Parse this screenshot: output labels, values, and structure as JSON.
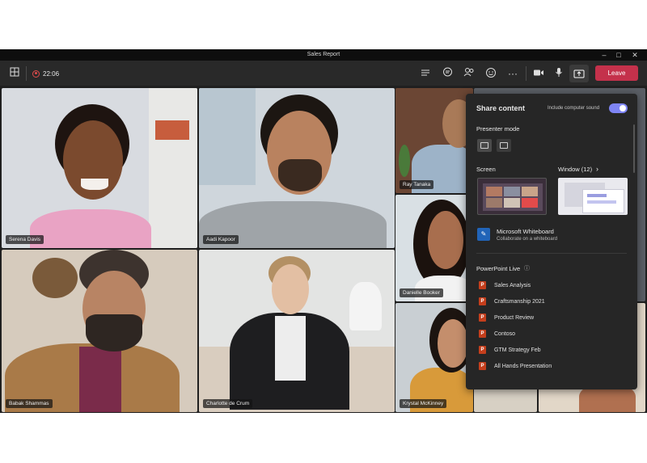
{
  "window": {
    "title": "Sales Report"
  },
  "toolbar": {
    "timer": "22:06",
    "leave_label": "Leave"
  },
  "participants": [
    {
      "name": "Serena Davis"
    },
    {
      "name": "Aadi Kapoor"
    },
    {
      "name": "Ray Tanaka"
    },
    {
      "name": "Danielle Booker"
    },
    {
      "name": "Babak Shammas"
    },
    {
      "name": "Charlotte de Crum"
    },
    {
      "name": "Krystal McKinney"
    }
  ],
  "share_panel": {
    "title": "Share content",
    "sound_label": "Include computer sound",
    "sound_on": true,
    "presenter_mode_label": "Presenter mode",
    "screen_label": "Screen",
    "window_label": "Window (12)",
    "whiteboard_title": "Microsoft Whiteboard",
    "whiteboard_subtitle": "Collaborate on a whiteboard",
    "ppt_label": "PowerPoint Live",
    "ppt_items": [
      "Sales Analysis",
      "Craftsmanship 2021",
      "Product Review",
      "Contoso",
      "GTM Strategy Feb",
      "All Hands Presentation"
    ]
  },
  "colors": {
    "accent": "#7f85f5",
    "leave": "#c4314b",
    "panel": "#262626"
  },
  "icons": [
    "grid-icon",
    "record-icon",
    "chat-list-icon",
    "chat-icon",
    "people-icon",
    "reactions-icon",
    "more-icon",
    "camera-icon",
    "mic-icon",
    "share-icon",
    "info-icon",
    "chevron-right-icon",
    "powerpoint-icon",
    "whiteboard-icon"
  ]
}
